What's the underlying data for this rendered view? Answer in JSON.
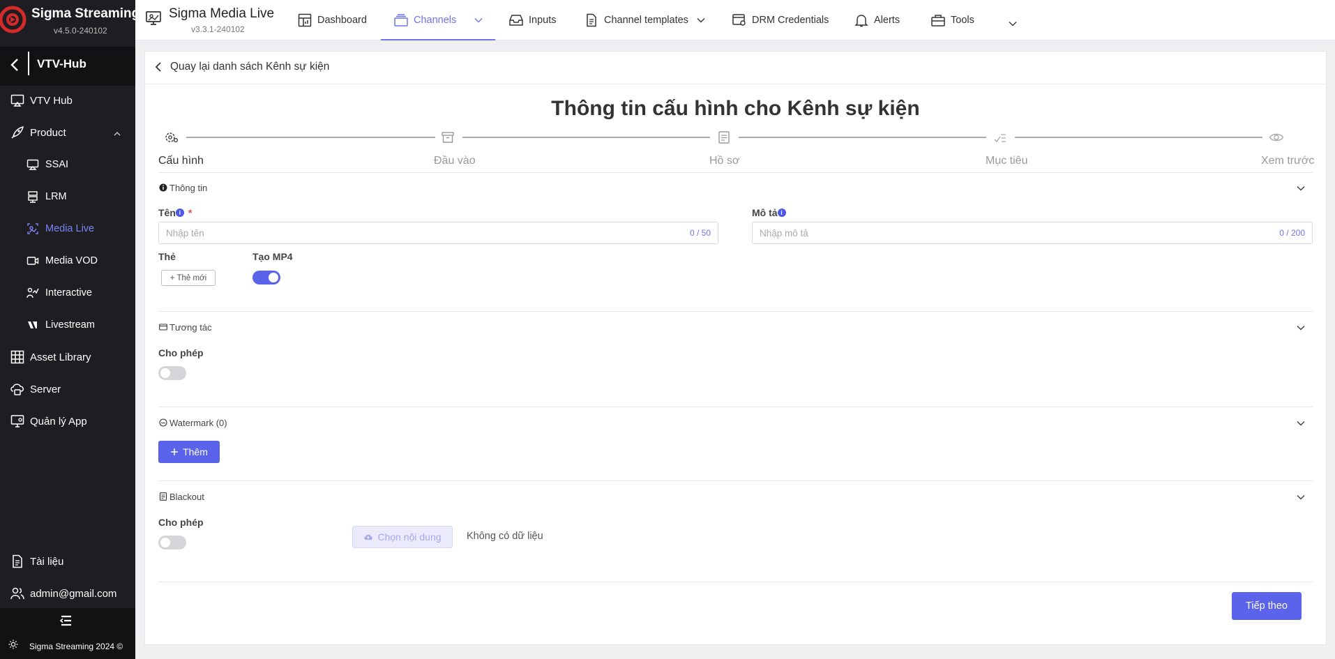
{
  "brand": {
    "name": "Sigma Streaming",
    "version": "v4.5.0-240102"
  },
  "hub": {
    "title": "VTV-Hub"
  },
  "sidebar": {
    "items": [
      {
        "label": "VTV Hub",
        "icon": "cast-icon"
      },
      {
        "label": "Product",
        "icon": "rocket-icon"
      },
      {
        "label": "SSAI",
        "icon": "cast-icon"
      },
      {
        "label": "LRM",
        "icon": "stack-icon"
      },
      {
        "label": "Media Live",
        "icon": "media-live-icon"
      },
      {
        "label": "Media VOD",
        "icon": "video-icon"
      },
      {
        "label": "Interactive",
        "icon": "user-chart-icon"
      },
      {
        "label": "Livestream",
        "icon": "livestream-icon"
      },
      {
        "label": "Asset Library",
        "icon": "grid-icon"
      },
      {
        "label": "Server",
        "icon": "cloud-server-icon"
      },
      {
        "label": "Quản lý App",
        "icon": "desktop-gear-icon"
      }
    ],
    "docs": "Tài liệu",
    "user": "admin@gmail.com",
    "copyright": "Sigma Streaming 2024 ©"
  },
  "app": {
    "name": "Sigma Media Live",
    "version": "v3.3.1-240102"
  },
  "tabs": [
    {
      "label": "Dashboard"
    },
    {
      "label": "Channels"
    },
    {
      "label": "Inputs"
    },
    {
      "label": "Channel templates"
    },
    {
      "label": "DRM Credentials"
    },
    {
      "label": "Alerts"
    },
    {
      "label": "Tools"
    }
  ],
  "page": {
    "back": "Quay lại danh sách Kênh sự kiện",
    "title": "Thông tin cấu hình cho Kênh sự kiện"
  },
  "steps": [
    {
      "label": "Cấu hình"
    },
    {
      "label": "Đầu vào"
    },
    {
      "label": "Hồ sơ"
    },
    {
      "label": "Mục tiêu"
    },
    {
      "label": "Xem trước"
    }
  ],
  "info": {
    "header": "Thông tin",
    "name_label": "Tên",
    "name_placeholder": "Nhập tên",
    "name_counter": "0 / 50",
    "desc_label": "Mô tả",
    "desc_placeholder": "Nhập mô tả",
    "desc_counter": "0 / 200",
    "tag_label": "Thẻ",
    "tag_button": "+ Thẻ mới",
    "mp4_label": "Tạo MP4",
    "mp4_enabled": true
  },
  "interaction": {
    "header": "Tương tác",
    "allow_label": "Cho phép",
    "allow_enabled": false
  },
  "watermark": {
    "header": "Watermark (0)",
    "add_button": "Thêm"
  },
  "blackout": {
    "header": "Blackout",
    "allow_label": "Cho phép",
    "allow_enabled": false,
    "choose_button": "Chọn nội dung",
    "no_data": "Không có dữ liệu"
  },
  "footer": {
    "next_button": "Tiếp theo"
  },
  "colors": {
    "accent": "#5b63ea",
    "sidebar_bg": "#1e1e22",
    "active_link": "#7b83f7",
    "brand_red": "#d42a2a"
  }
}
